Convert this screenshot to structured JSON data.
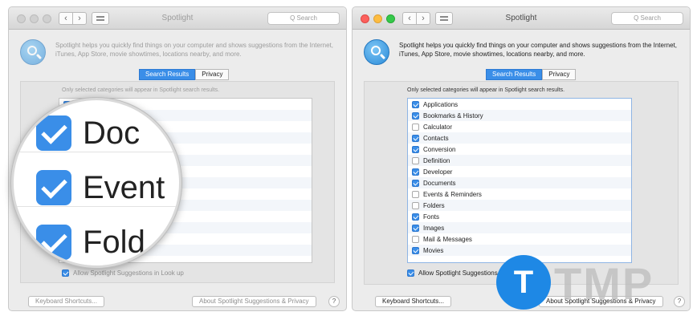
{
  "window_title": "Spotlight",
  "search_placeholder": "Q Search",
  "intro_text": "Spotlight helps you quickly find things on your computer and shows suggestions from the Internet, iTunes, App Store, movie showtimes, locations nearby, and more.",
  "tabs": [
    "Search Results",
    "Privacy"
  ],
  "hint": "Only selected categories will appear in Spotlight search results.",
  "categories": [
    {
      "label": "Applications",
      "checked": true
    },
    {
      "label": "Bookmarks & History",
      "checked": true
    },
    {
      "label": "Calculator",
      "checked": false
    },
    {
      "label": "Contacts",
      "checked": true
    },
    {
      "label": "Conversion",
      "checked": true
    },
    {
      "label": "Definition",
      "checked": false
    },
    {
      "label": "Developer",
      "checked": true
    },
    {
      "label": "Documents",
      "checked": true
    },
    {
      "label": "Events & Reminders",
      "checked": false
    },
    {
      "label": "Folders",
      "checked": false
    },
    {
      "label": "Fonts",
      "checked": true
    },
    {
      "label": "Images",
      "checked": true
    },
    {
      "label": "Mail & Messages",
      "checked": false
    },
    {
      "label": "Movies",
      "checked": true
    }
  ],
  "allow_label": "Allow Spotlight Suggestions in Look up",
  "allow_checked": true,
  "keyboard_shortcuts_label": "Keyboard Shortcuts...",
  "about_label": "About Spotlight Suggestions & Privacy",
  "help_label": "?",
  "nav": {
    "back": "‹",
    "forward": "›"
  },
  "magnifier": {
    "items": [
      {
        "label": "Doc"
      },
      {
        "label": "Event"
      },
      {
        "label": "Fold"
      }
    ]
  },
  "watermark": {
    "text": "TMP",
    "logo_letter": "T"
  },
  "colors": {
    "accent": "#3a8ee8",
    "close": "#fc605c",
    "minimize": "#fdbc40",
    "zoom": "#34c84a"
  }
}
